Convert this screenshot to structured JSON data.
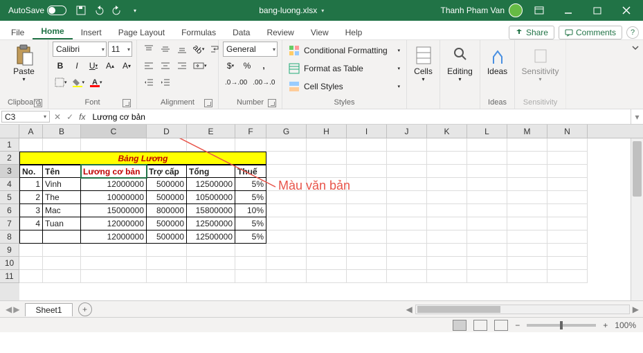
{
  "titlebar": {
    "autosave": "AutoSave",
    "filename": "bang-luong.xlsx",
    "username": "Thanh Pham Van"
  },
  "tabs": {
    "list": [
      "File",
      "Home",
      "Insert",
      "Page Layout",
      "Formulas",
      "Data",
      "Review",
      "View",
      "Help"
    ],
    "active": 1,
    "share": "Share",
    "comments": "Comments"
  },
  "ribbon": {
    "clipboard": {
      "paste": "Paste",
      "label": "Clipboard"
    },
    "font": {
      "name": "Calibri",
      "size": "11",
      "label": "Font"
    },
    "alignment": {
      "label": "Alignment"
    },
    "number": {
      "format": "General",
      "label": "Number"
    },
    "styles": {
      "cf": "Conditional Formatting",
      "fat": "Format as Table",
      "cs": "Cell Styles",
      "label": "Styles"
    },
    "cells": {
      "label": "Cells"
    },
    "editing": {
      "label": "Editing"
    },
    "ideas": {
      "btn": "Ideas",
      "label": "Ideas"
    },
    "sensitivity": {
      "btn": "Sensitivity",
      "label": "Sensitivity"
    }
  },
  "formula": {
    "ref": "C3",
    "value": "Lương cơ bản"
  },
  "columns": [
    {
      "l": "A",
      "w": 34
    },
    {
      "l": "B",
      "w": 55
    },
    {
      "l": "C",
      "w": 95
    },
    {
      "l": "D",
      "w": 58
    },
    {
      "l": "E",
      "w": 70
    },
    {
      "l": "F",
      "w": 45
    },
    {
      "l": "G",
      "w": 58
    },
    {
      "l": "H",
      "w": 58
    },
    {
      "l": "I",
      "w": 58
    },
    {
      "l": "J",
      "w": 58
    },
    {
      "l": "K",
      "w": 58
    },
    {
      "l": "L",
      "w": 58
    },
    {
      "l": "M",
      "w": 58
    },
    {
      "l": "N",
      "w": 58
    }
  ],
  "rows": 11,
  "selected": {
    "col": 2,
    "row": 2
  },
  "table": {
    "title": "Bảng Lương",
    "titleSpan": {
      "c0": 0,
      "c1": 5,
      "row": 1
    },
    "headers": [
      "No.",
      "Tên",
      "Lương cơ bản",
      "Trợ cấp",
      "Tổng",
      "Thuế"
    ],
    "headerRow": 2,
    "redHeaderCol": 2,
    "data": [
      {
        "no": 1,
        "ten": "Vinh",
        "luong": 12000000,
        "trocap": 500000,
        "tong": 12500000,
        "thue": "5%"
      },
      {
        "no": 2,
        "ten": "The",
        "luong": 10000000,
        "trocap": 500000,
        "tong": 10500000,
        "thue": "5%"
      },
      {
        "no": 3,
        "ten": "Mac",
        "luong": 15000000,
        "trocap": 800000,
        "tong": 15800000,
        "thue": "10%"
      },
      {
        "no": 4,
        "ten": "Tuan",
        "luong": 12000000,
        "trocap": 500000,
        "tong": 12500000,
        "thue": "5%"
      },
      {
        "no": "",
        "ten": "",
        "luong": 12000000,
        "trocap": 500000,
        "tong": 12500000,
        "thue": "5%"
      }
    ],
    "dataStartRow": 3
  },
  "annotation": {
    "text": "Màu văn bản"
  },
  "sheets": {
    "active": "Sheet1"
  },
  "statusbar": {
    "zoom": "100%"
  },
  "chart_data": {
    "type": "table",
    "title": "Bảng Lương",
    "columns": [
      "No.",
      "Tên",
      "Lương cơ bản",
      "Trợ cấp",
      "Tổng",
      "Thuế"
    ],
    "rows": [
      [
        1,
        "Vinh",
        12000000,
        500000,
        12500000,
        "5%"
      ],
      [
        2,
        "The",
        10000000,
        500000,
        10500000,
        "5%"
      ],
      [
        3,
        "Mac",
        15000000,
        800000,
        15800000,
        "10%"
      ],
      [
        4,
        "Tuan",
        12000000,
        500000,
        12500000,
        "5%"
      ],
      [
        "",
        "",
        12000000,
        500000,
        12500000,
        "5%"
      ]
    ]
  }
}
